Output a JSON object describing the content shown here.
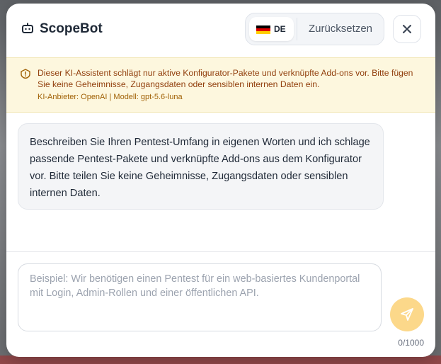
{
  "header": {
    "title": "ScopeBot",
    "icon": "robot-icon",
    "language": {
      "code": "DE",
      "flag_colors": [
        "#000000",
        "#dd0000",
        "#ffce00"
      ]
    },
    "reset_label": "Zurücksetzen",
    "close_icon": "close-icon"
  },
  "notice": {
    "icon": "alert-circle-icon",
    "text": "Dieser KI-Assistent schlägt nur aktive Konfigurator-Pakete und verknüpfte Add-ons vor. Bitte fügen Sie keine Geheimnisse, Zugangsdaten oder sensiblen internen Daten ein.",
    "meta": "KI-Anbieter: OpenAI | Modell: gpt-5.6-luna"
  },
  "chat": {
    "messages": [
      {
        "role": "assistant",
        "text": "Beschreiben Sie Ihren Pentest-Umfang in eigenen Worten und ich schlage passende Pentest-Pakete und verknüpfte Add-ons aus dem Konfigurator vor. Bitte teilen Sie keine Geheimnisse, Zugangsdaten oder sensiblen internen Daten."
      }
    ]
  },
  "composer": {
    "value": "",
    "placeholder": "Beispiel: Wir benötigen einen Pentest für ein web-basiertes Kundenportal mit Login, Admin-Rollen und einer öffentlichen API.",
    "counter": "0/1000",
    "send_icon": "send-icon"
  },
  "colors": {
    "accent": "#fcd88a",
    "notice_bg": "#fdf7de",
    "notice_text": "#92400e"
  }
}
